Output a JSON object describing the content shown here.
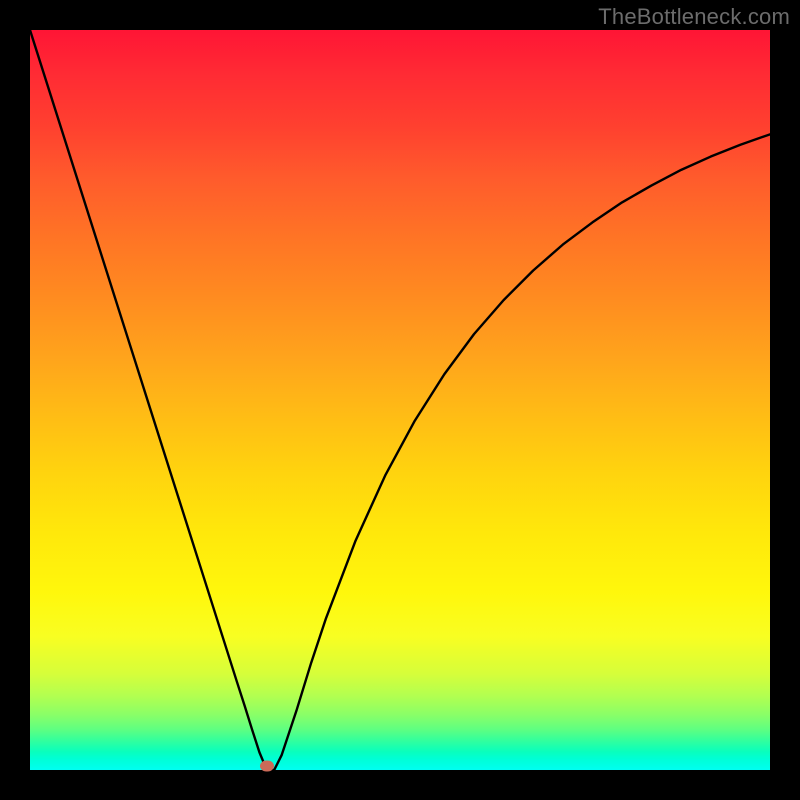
{
  "watermark": "TheBottleneck.com",
  "chart_data": {
    "type": "line",
    "title": "",
    "xlabel": "",
    "ylabel": "",
    "xlim": [
      0,
      100
    ],
    "ylim": [
      0,
      100
    ],
    "series": [
      {
        "name": "bottleneck-curve",
        "x": [
          0,
          4,
          8,
          12,
          16,
          20,
          24,
          26,
          28,
          29,
          30,
          31,
          32,
          33,
          34,
          36,
          38,
          40,
          44,
          48,
          52,
          56,
          60,
          64,
          68,
          72,
          76,
          80,
          84,
          88,
          92,
          96,
          100
        ],
        "y": [
          100,
          87.4,
          74.8,
          62.2,
          49.6,
          37.0,
          24.4,
          18.1,
          11.8,
          8.7,
          5.5,
          2.4,
          0.0,
          0.0,
          2.0,
          8.0,
          14.5,
          20.5,
          31.0,
          39.8,
          47.2,
          53.5,
          58.9,
          63.5,
          67.5,
          71.0,
          74.0,
          76.7,
          79.0,
          81.1,
          82.9,
          84.5,
          85.9
        ]
      }
    ],
    "marker": {
      "x": 32,
      "y": 0.5
    },
    "background_gradient": {
      "orientation": "vertical",
      "stops": [
        {
          "pct": 0,
          "color": "#ff1535"
        },
        {
          "pct": 50,
          "color": "#ffc015"
        },
        {
          "pct": 82,
          "color": "#f8fe22"
        },
        {
          "pct": 100,
          "color": "#00fff0"
        }
      ]
    }
  }
}
